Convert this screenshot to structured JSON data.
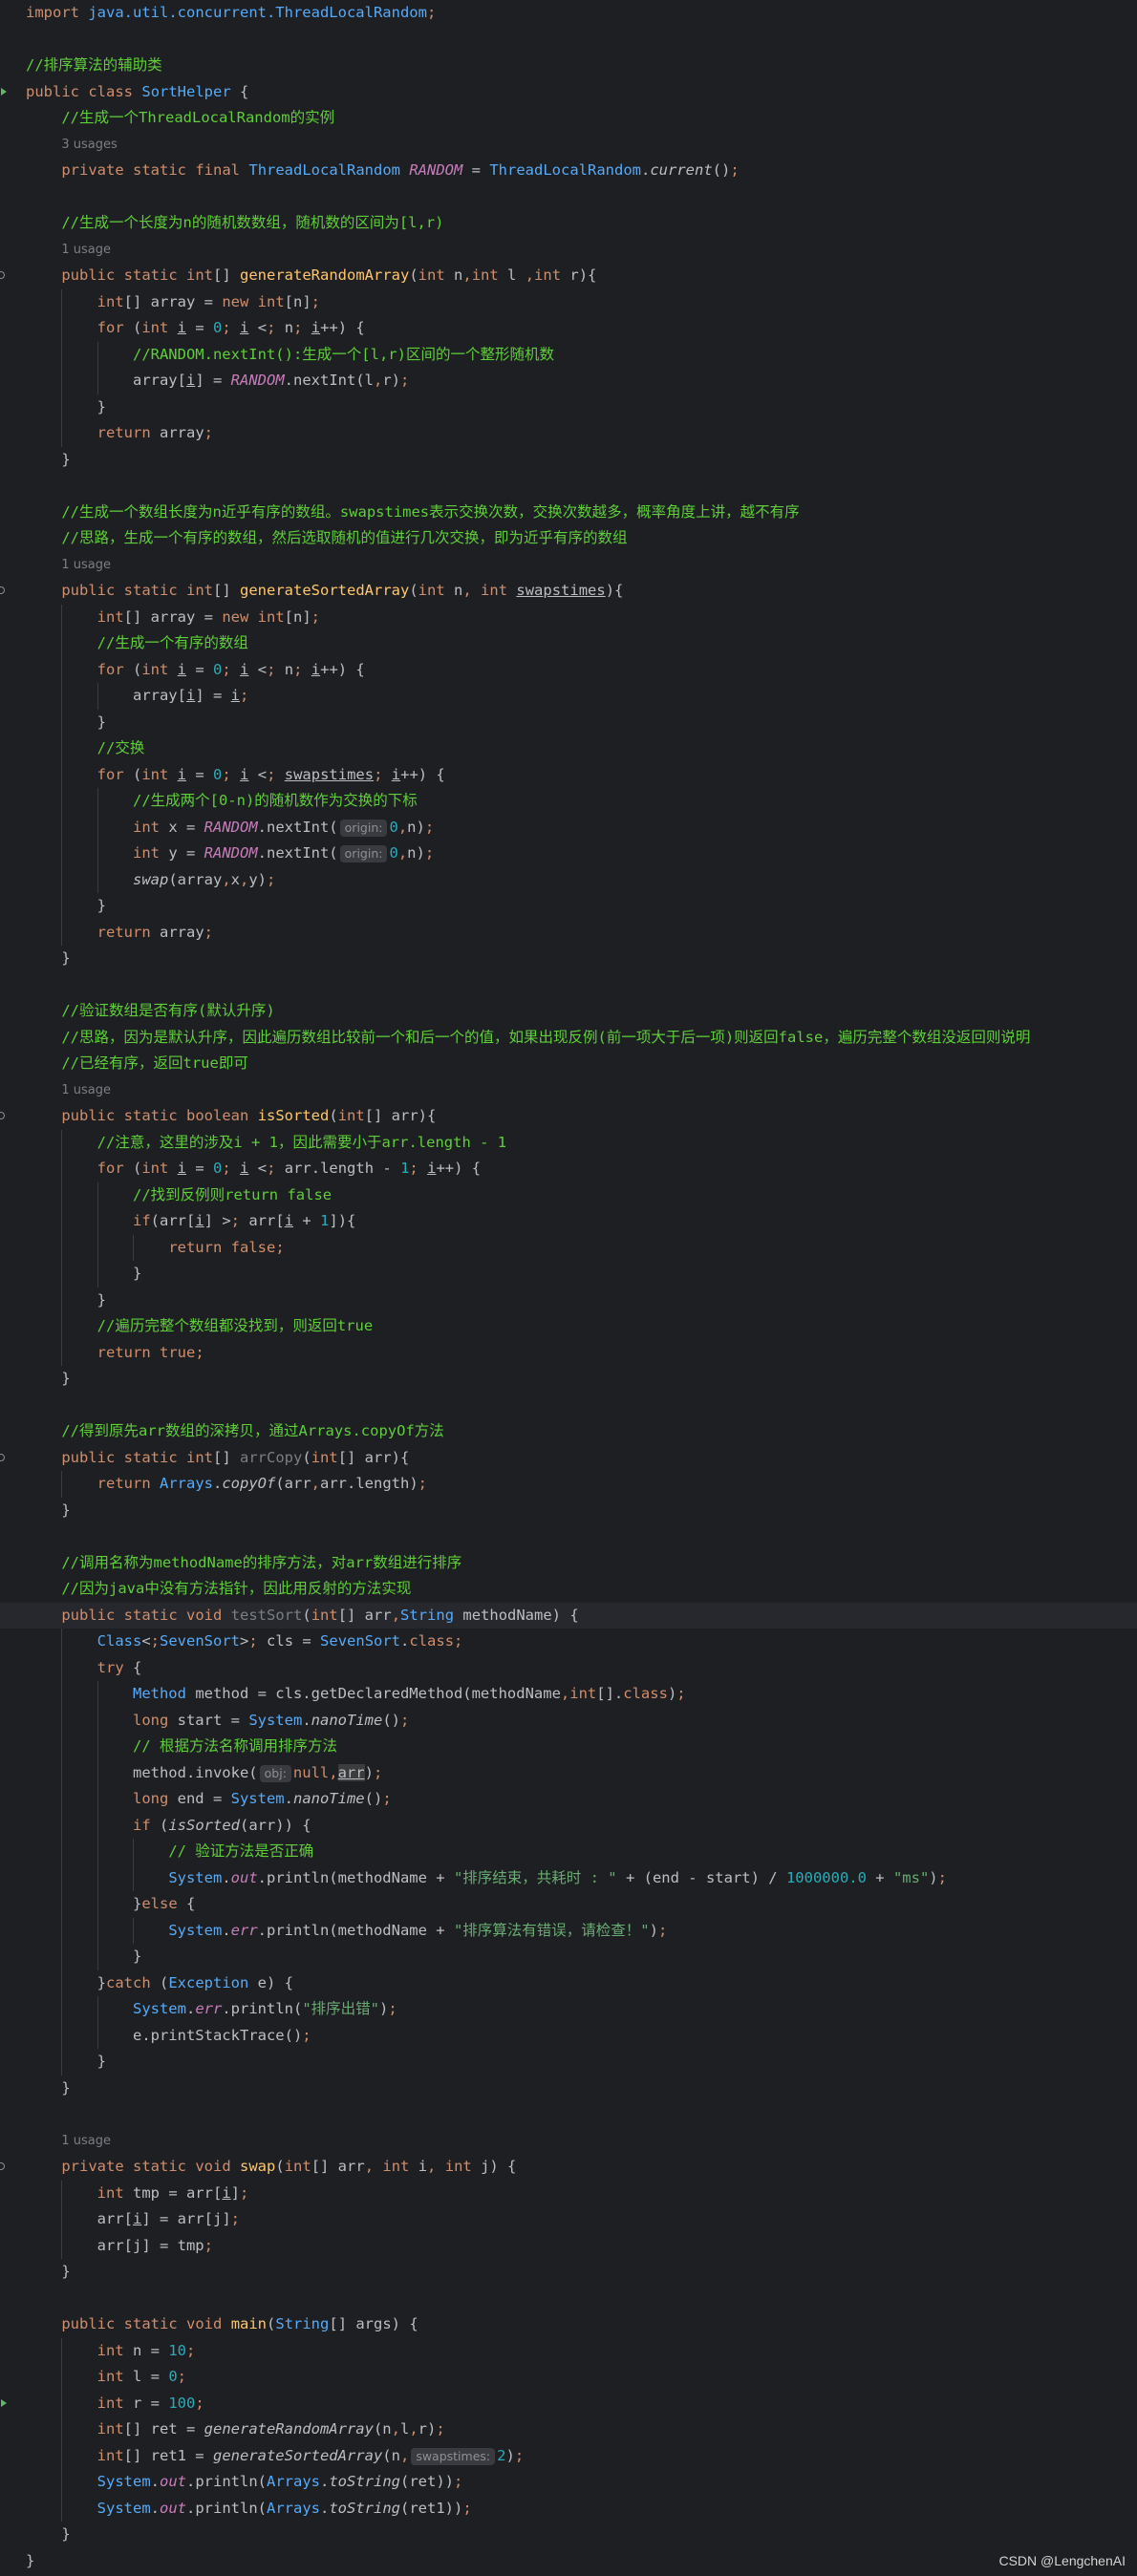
{
  "editor": {
    "language": "java",
    "file_class": "SortHelper",
    "highlighted_line": 61,
    "usage_hints": [
      "3 usages",
      "1 usage",
      "1 usage",
      "1 usage",
      "1 usage"
    ],
    "lines": [
      "import java.util.concurrent.ThreadLocalRandom;",
      "",
      "//排序算法的辅助类",
      "public class SortHelper {",
      "    //生成一个ThreadLocalRandom的实例",
      "    3 usages",
      "    private static final ThreadLocalRandom RANDOM = ThreadLocalRandom.current();",
      "",
      "    //生成一个长度为n的随机数数组，随机数的区间为[l,r)",
      "    1 usage",
      "    public static int[] generateRandomArray(int n,int l ,int r){",
      "        int[] array = new int[n];",
      "        for (int i = 0; i < n; i++) {",
      "            //RANDOM.nextInt():生成一个[l,r)区间的一个整形随机数",
      "            array[i] = RANDOM.nextInt(l,r);",
      "        }",
      "        return array;",
      "    }",
      "",
      "    //生成一个数组长度为n近乎有序的数组。swapstimes表示交换次数，交换次数越多，概率角度上讲，越不有序",
      "    //思路，生成一个有序的数组，然后选取随机的值进行几次交换，即为近乎有序的数组",
      "    1 usage",
      "    public static int[] generateSortedArray(int n, int swapstimes){",
      "        int[] array = new int[n];",
      "        //生成一个有序的数组",
      "        for (int i = 0; i < n; i++) {",
      "            array[i] = i;",
      "        }",
      "        //交换",
      "        for (int i = 0; i < swapstimes; i++) {",
      "            //生成两个[0-n)的随机数作为交换的下标",
      "            int x = RANDOM.nextInt( origin: 0,n);",
      "            int y = RANDOM.nextInt( origin: 0,n);",
      "            swap(array,x,y);",
      "        }",
      "        return array;",
      "    }",
      "",
      "    //验证数组是否有序(默认升序)",
      "    //思路，因为是默认升序，因此遍历数组比较前一个和后一个的值，如果出现反例(前一项大于后一项)则返回false，遍历完整个数组没返回则说明",
      "    //已经有序，返回true即可",
      "    1 usage",
      "    public static boolean isSorted(int[] arr){",
      "        //注意，这里的涉及i + 1，因此需要小于arr.length - 1",
      "        for (int i = 0; i < arr.length - 1; i++) {",
      "            //找到反例则return false",
      "            if(arr[i] > arr[i + 1]){",
      "                return false;",
      "            }",
      "        }",
      "        //遍历完整个数组都没找到，则返回true",
      "        return true;",
      "    }",
      "",
      "    //得到原先arr数组的深拷贝，通过Arrays.copyOf方法",
      "    public static int[] arrCopy(int[] arr){",
      "        return Arrays.copyOf(arr,arr.length);",
      "    }",
      "",
      "    //调用名称为methodName的排序方法，对arr数组进行排序",
      "    //因为java中没有方法指针，因此用反射的方法实现",
      "    public static void testSort(int[] arr,String methodName) {",
      "        Class<SevenSort> cls = SevenSort.class;",
      "        try {",
      "            Method method = cls.getDeclaredMethod(methodName,int[].class);",
      "            long start = System.nanoTime();",
      "            // 根据方法名称调用排序方法",
      "            method.invoke( obj: null,arr);",
      "            long end = System.nanoTime();",
      "            if (isSorted(arr)) {",
      "                // 验证方法是否正确",
      "                System.out.println(methodName + \"排序结束，共耗时 : \" + (end - start) / 1000000.0 + \"ms\");",
      "            }else {",
      "                System.err.println(methodName + \"排序算法有错误，请检查！\");",
      "            }",
      "        }catch (Exception e) {",
      "            System.err.println(\"排序出错\");",
      "            e.printStackTrace();",
      "        }",
      "    }",
      "",
      "    1 usage",
      "    private static void swap(int[] arr, int i, int j) {",
      "        int tmp = arr[i];",
      "        arr[i] = arr[j];",
      "        arr[j] = tmp;",
      "    }",
      "",
      "    public static void main(String[] args) {",
      "        int n = 10;",
      "        int l = 0;",
      "        int r = 100;",
      "        int[] ret = generateRandomArray(n,l,r);",
      "        int[] ret1 = generateSortedArray(n, swapstimes: 2);",
      "        System.out.println(Arrays.toString(ret));",
      "        System.out.println(Arrays.toString(ret1));",
      "    }",
      "}"
    ]
  },
  "watermark": "CSDN @LengchenAI"
}
